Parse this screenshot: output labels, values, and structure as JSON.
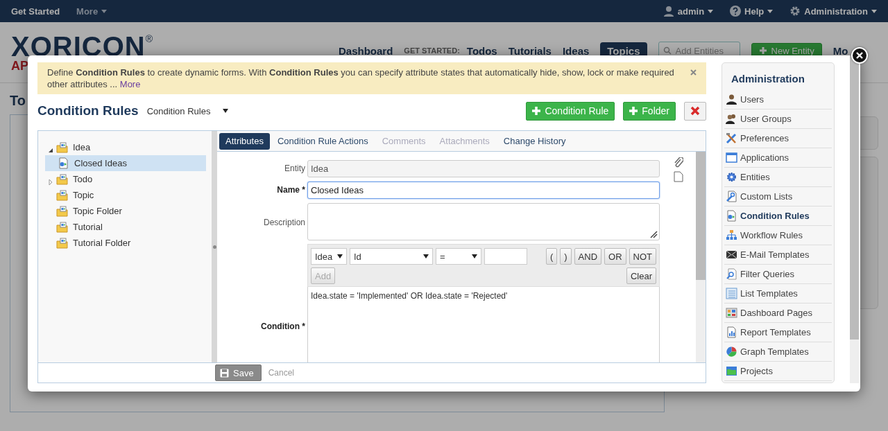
{
  "top_bar": {
    "left": [
      {
        "label": "Get Started",
        "caret": false
      },
      {
        "label": "More",
        "caret": true
      }
    ],
    "right": [
      {
        "kind": "user",
        "label": "admin"
      },
      {
        "kind": "help",
        "label": "Help"
      },
      {
        "kind": "gear",
        "label": "Administration"
      }
    ]
  },
  "header": {
    "logo": {
      "text": "XORICON",
      "mark": "®",
      "tagline": "AP"
    },
    "nav": [
      {
        "label": "Dashboard",
        "selected": false
      }
    ],
    "get_started_label": "GET STARTED:",
    "get_started_nav": [
      {
        "label": "Todos",
        "selected": false
      },
      {
        "label": "Tutorials",
        "selected": false
      },
      {
        "label": "Ideas",
        "selected": false
      },
      {
        "label": "Topics",
        "selected": true
      }
    ],
    "search": {
      "placeholder": "Add Entities"
    },
    "new_entity_button": "New Entity",
    "more_menu": "Mo"
  },
  "page": {
    "title": "To"
  },
  "modal": {
    "banner": {
      "text": "Define **Condition Rules** to create dynamic forms. With **Condition Rules** you can specify attribute states that automatically hide, show, lock or make required other attributes ...",
      "link": "More"
    },
    "title": "Condition Rules",
    "selector": "Condition Rules",
    "buttons": [
      {
        "kind": "add",
        "label": "Condition Rule"
      },
      {
        "kind": "add",
        "label": "Folder"
      },
      {
        "kind": "delete"
      }
    ],
    "tree": [
      {
        "kind": "folder",
        "label": "Idea",
        "expanded": true,
        "selected": false,
        "children": [
          {
            "kind": "rule",
            "label": "Closed Ideas",
            "selected": true
          }
        ]
      },
      {
        "kind": "folder",
        "label": "Todo",
        "expanded": false,
        "selected": false
      },
      {
        "kind": "folder",
        "label": "Topic",
        "selected": false
      },
      {
        "kind": "folder",
        "label": "Topic Folder",
        "selected": false
      },
      {
        "kind": "folder",
        "label": "Tutorial",
        "selected": false
      },
      {
        "kind": "folder",
        "label": "Tutorial Folder",
        "selected": false
      }
    ],
    "tabs": [
      {
        "label": "Attributes",
        "selected": true,
        "disabled": false
      },
      {
        "label": "Condition Rule Actions",
        "selected": false,
        "disabled": false
      },
      {
        "label": "Comments",
        "selected": false,
        "disabled": true
      },
      {
        "label": "Attachments",
        "selected": false,
        "disabled": true
      },
      {
        "label": "Change History",
        "selected": false,
        "disabled": false
      }
    ],
    "form": {
      "entity": {
        "label": "Entity",
        "value": "Idea"
      },
      "name": {
        "label": "Name *",
        "value": "Closed Ideas",
        "focused": true
      },
      "description": {
        "label": "Description"
      },
      "condition": {
        "label": "Condition *",
        "value": "Idea.state = 'Implemented' OR Idea.state = 'Rejected'",
        "selects": [
          {
            "value": "Idea"
          },
          {
            "value": "Id"
          },
          {
            "value": "="
          }
        ],
        "operators": [
          "(",
          ")",
          "AND",
          "OR",
          "NOT"
        ],
        "add": {
          "label": "Add",
          "disabled": true
        },
        "clear": "Clear"
      }
    },
    "footer": {
      "save": "Save",
      "cancel": "Cancel"
    },
    "sidebar": {
      "title": "Administration",
      "items": [
        {
          "kind": "user",
          "label": "Users",
          "selected": false
        },
        {
          "kind": "users",
          "label": "User Groups",
          "selected": false
        },
        {
          "kind": "tools",
          "label": "Preferences",
          "selected": false
        },
        {
          "kind": "window",
          "label": "Applications",
          "selected": false
        },
        {
          "kind": "gear",
          "label": "Entities",
          "selected": false
        },
        {
          "kind": "wrench",
          "label": "Custom Lists",
          "selected": false
        },
        {
          "kind": "rule",
          "label": "Condition Rules",
          "selected": true
        },
        {
          "kind": "sitemap",
          "label": "Workflow Rules",
          "selected": false
        },
        {
          "kind": "envelope",
          "label": "E-Mail Templates",
          "selected": false
        },
        {
          "kind": "search",
          "label": "Filter Queries",
          "selected": false
        },
        {
          "kind": "list",
          "label": "List Templates",
          "selected": false
        },
        {
          "kind": "dashboard",
          "label": "Dashboard Pages",
          "selected": false
        },
        {
          "kind": "chart",
          "label": "Report Templates",
          "selected": false
        },
        {
          "kind": "pie",
          "label": "Graph Templates",
          "selected": false
        },
        {
          "kind": "folder",
          "label": "Projects",
          "selected": false
        }
      ]
    }
  }
}
